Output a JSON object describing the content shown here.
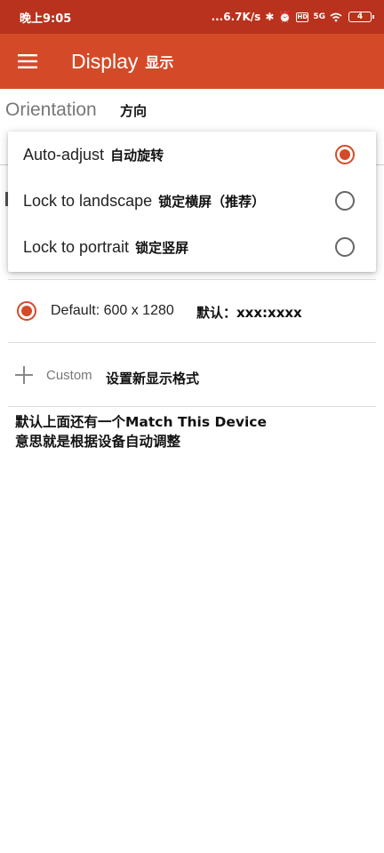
{
  "status_bar": {
    "time": "晚上9:05",
    "speed": "...6.7K/s",
    "battery": "4",
    "hd_label": "HD",
    "net_label": "5G",
    "bluetooth_glyph": "✱",
    "alarm_glyph": "⏰"
  },
  "app_bar": {
    "title": "Display",
    "title_cn": "显示",
    "menu_icon": "hamburger-menu-icon"
  },
  "orientation": {
    "label": "Orientation",
    "label_cn": "方向"
  },
  "orientation_menu": [
    {
      "label": "Auto-adjust",
      "label_cn": "自动旋转",
      "selected": true
    },
    {
      "label": "Lock to landscape",
      "label_cn": "锁定横屏（推荐）",
      "selected": false
    },
    {
      "label": "Lock to portrait",
      "label_cn": "锁定竖屏",
      "selected": false
    }
  ],
  "resolution": {
    "default_label": "Default: 600 x 1280",
    "default_cn": "默认：xxx:xxxx",
    "selected": true
  },
  "custom": {
    "label": "Custom",
    "label_cn": "设置新显示格式"
  },
  "note": {
    "line1": "默认上面还有一个Match This Device",
    "line2": "意思就是根据设备自动调整"
  },
  "colors": {
    "status_bar": "#b8321d",
    "app_bar": "#d44a28",
    "accent": "#d44a28"
  }
}
